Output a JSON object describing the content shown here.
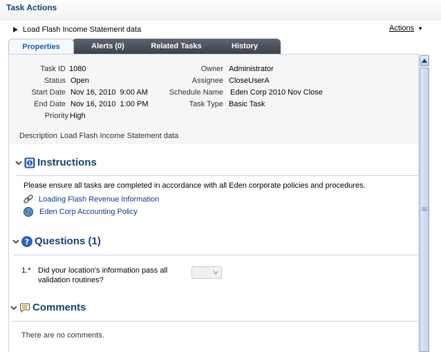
{
  "window": {
    "title": "Task Actions"
  },
  "task": {
    "name": "Load Flash Income Statement data"
  },
  "actions_menu": {
    "label": "Actions"
  },
  "tabs": [
    {
      "label": "Properties",
      "active": true
    },
    {
      "label": "Alerts (0)",
      "active": false
    },
    {
      "label": "Related Tasks",
      "active": false
    },
    {
      "label": "History",
      "active": false
    }
  ],
  "properties": {
    "task_id": {
      "label": "Task ID",
      "value": "1080"
    },
    "status": {
      "label": "Status",
      "value": "Open"
    },
    "start_date": {
      "label": "Start Date",
      "value": "Nov 16, 2010  9:00 AM"
    },
    "end_date": {
      "label": "End Date",
      "value": "Nov 16, 2010  1:00 PM"
    },
    "priority": {
      "label": "Priority",
      "value": "High"
    },
    "owner": {
      "label": "Owner",
      "value": "Administrator"
    },
    "assignee": {
      "label": "Assignee",
      "value": "CloseUserA"
    },
    "schedule_name": {
      "label": "Schedule Name",
      "value": "Eden Corp 2010 Nov Close"
    },
    "task_type": {
      "label": "Task Type",
      "value": "Basic Task"
    },
    "description": {
      "label": "Description",
      "value": "Load Flash Income Statement data"
    }
  },
  "instructions": {
    "title": "Instructions",
    "text": "Please ensure all tasks are completed in accordance with all Eden corporate policies and procedures.",
    "links": [
      {
        "label": "Loading Flash Revenue Information",
        "icon": "chain-link-icon"
      },
      {
        "label": "Eden Corp Accounting Policy",
        "icon": "globe-icon"
      }
    ]
  },
  "questions": {
    "title": "Questions (1)",
    "items": [
      {
        "number": "1.*",
        "text_line1": "Did your location's information pass all",
        "text_line2": "validation routines?",
        "answer": ""
      }
    ]
  },
  "comments": {
    "title": "Comments",
    "empty_text": "There are no comments."
  },
  "colors": {
    "heading": "#1c3f6e",
    "active_tab_text": "#1f5da8",
    "inactive_tab_bg": "#3c424b",
    "link": "#0b3c8c"
  }
}
